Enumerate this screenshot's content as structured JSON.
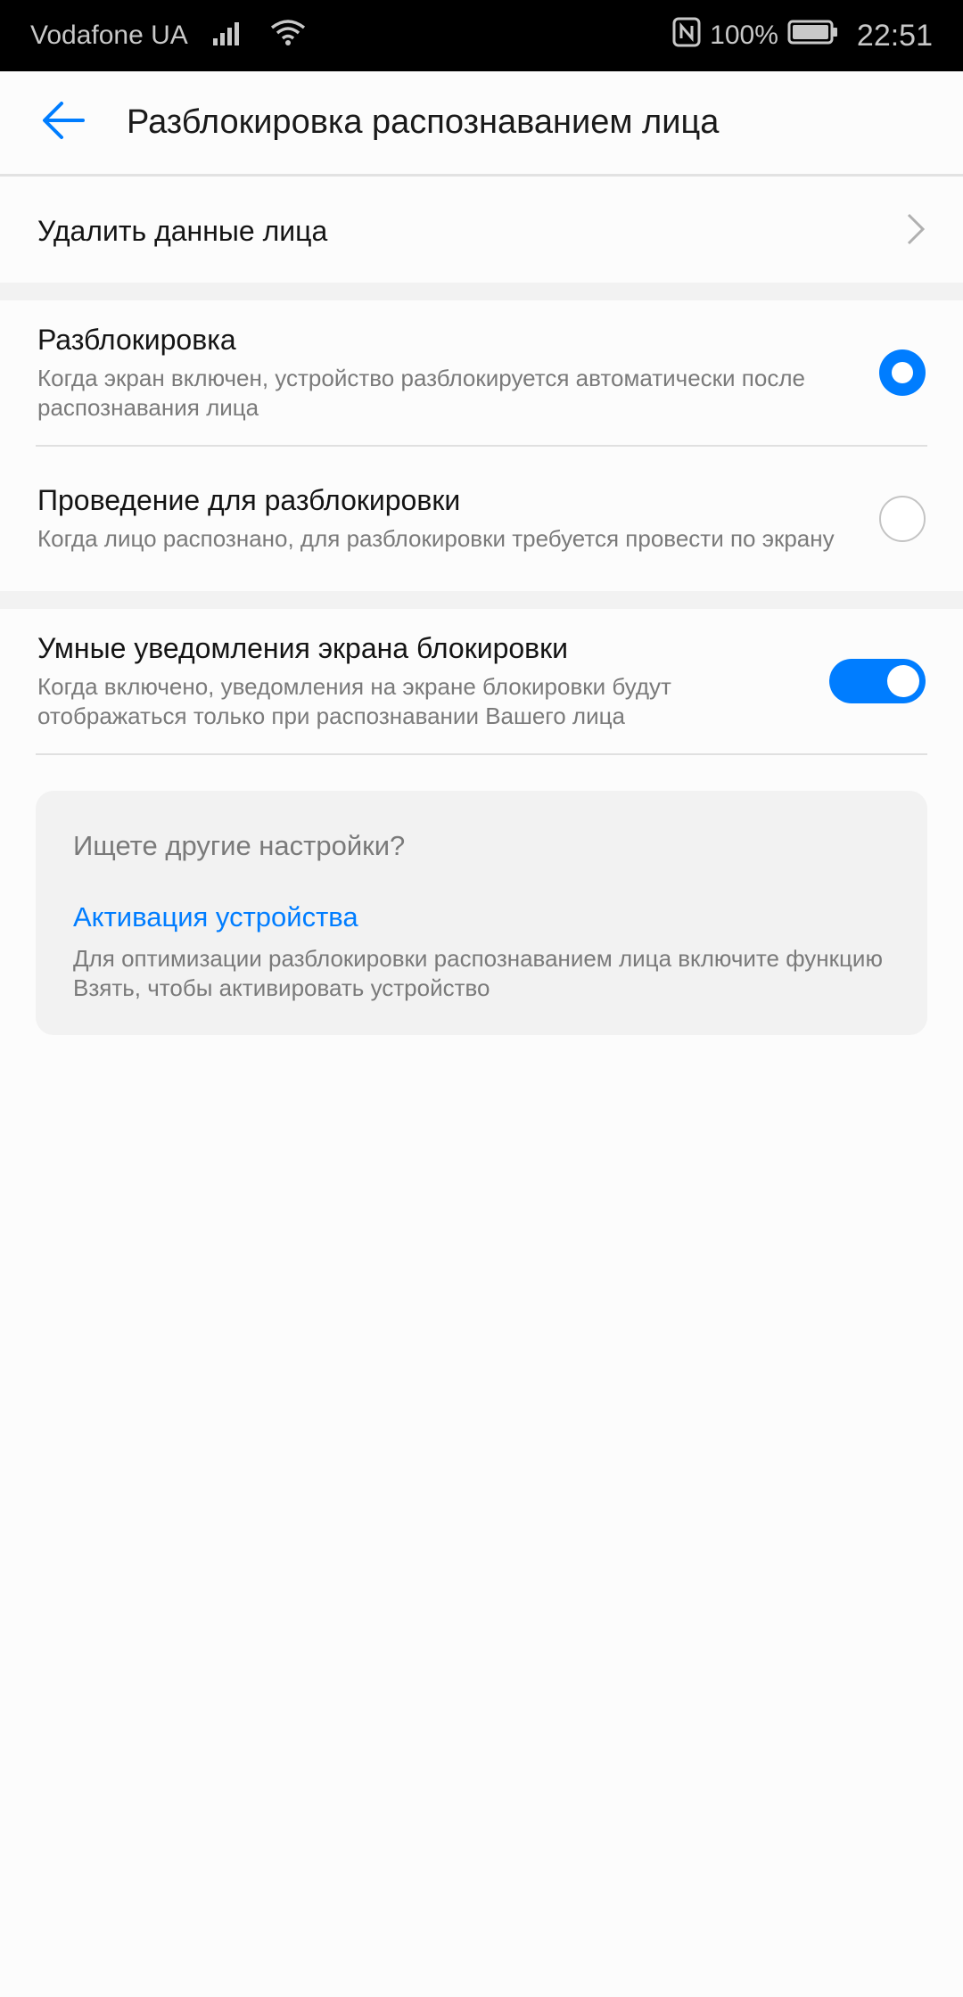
{
  "status_bar": {
    "carrier": "Vodafone UA",
    "battery": "100%",
    "time": "22:51",
    "icons": [
      "signal-icon",
      "wifi-icon",
      "nfc-icon",
      "battery-icon"
    ]
  },
  "appbar": {
    "title": "Разблокировка распознаванием лица",
    "back_icon": "arrow-left-icon"
  },
  "delete_row": {
    "label": "Удалить данные лица",
    "icon": "chevron-right-icon"
  },
  "unlock_options": [
    {
      "title": "Разблокировка",
      "description": "Когда экран включен, устройство разблокируется автоматически после распознавания лица",
      "selected": true
    },
    {
      "title": "Проведение для разблокировки",
      "description": "Когда лицо распознано, для разблокировки требуется провести по экрану",
      "selected": false
    }
  ],
  "smart_notifications": {
    "title": "Умные уведомления экрана блокировки",
    "description": "Когда включено, уведомления на экране блокировки будут отображаться только при распознавании Вашего лица",
    "enabled": true
  },
  "suggestions": {
    "question": "Ищете другие настройки?",
    "link": "Активация устройства",
    "description": "Для оптимизации разблокировки распознаванием лица включите функцию Взять, чтобы активировать устройство"
  },
  "colors": {
    "accent": "#007dff",
    "status_bar_bg": "#000000",
    "secondary_text": "#7a7a7a"
  }
}
